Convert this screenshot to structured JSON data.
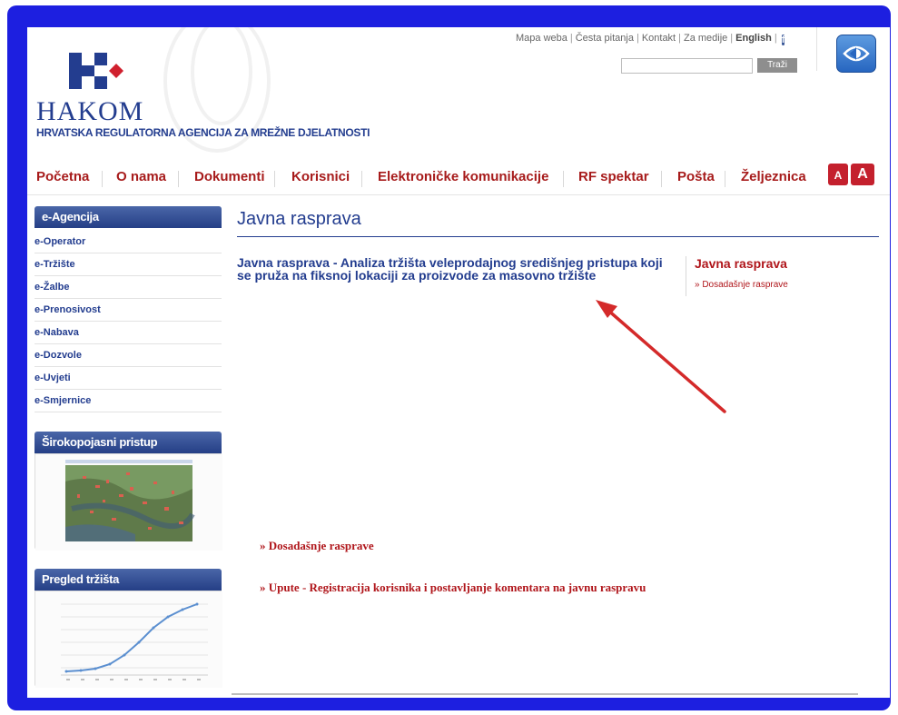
{
  "top_links": {
    "sitemap": "Mapa weba",
    "faq": "Česta pitanja",
    "contact": "Kontakt",
    "media": "Za medije",
    "english": "English",
    "separator": "|"
  },
  "search": {
    "value": "",
    "button_label": "Traži"
  },
  "brand": {
    "name": "HAKOM",
    "tagline": "HRVATSKA REGULATORNA AGENCIJA ZA MREŽNE DJELATNOSTI"
  },
  "nav": {
    "items": [
      "Početna",
      "O nama",
      "Dokumenti",
      "Korisnici",
      "Elektroničke komunikacije",
      "RF spektar",
      "Pošta",
      "Željeznica"
    ],
    "font_small": "A",
    "font_large": "A"
  },
  "sidebar": {
    "eagency_title": "e-Agencija",
    "items": [
      "e-Operator",
      "e-Tržište",
      "e-Žalbe",
      "e-Prenosivost",
      "e-Nabava",
      "e-Dozvole",
      "e-Uvjeti",
      "e-Smjernice"
    ],
    "broadband_title": "Širokopojasni pristup",
    "market_title": "Pregled tržišta"
  },
  "main": {
    "title": "Javna rasprava",
    "article_title": "Javna rasprava - Analiza tržišta veleprodajnog središnjeg pristupa koji se pruža na fiksnoj lokaciji za proizvode za masovno tržište",
    "side_title": "Javna rasprava",
    "side_link": "» Dosadašnje rasprave",
    "bottom_link_1": "» Dosadašnje rasprave",
    "bottom_link_2": "» Upute - Registracija korisnika i postavljanje komentara na javnu raspravu"
  },
  "colors": {
    "frame": "#1d1fe0",
    "brand_blue": "#233d8f",
    "nav_red": "#a71b1b",
    "link_red": "#b0161b",
    "annotation_arrow": "#d42a2a"
  },
  "icons": [
    "facebook-icon",
    "accessibility-icon",
    "hakom-logo",
    "annotation-arrow"
  ]
}
